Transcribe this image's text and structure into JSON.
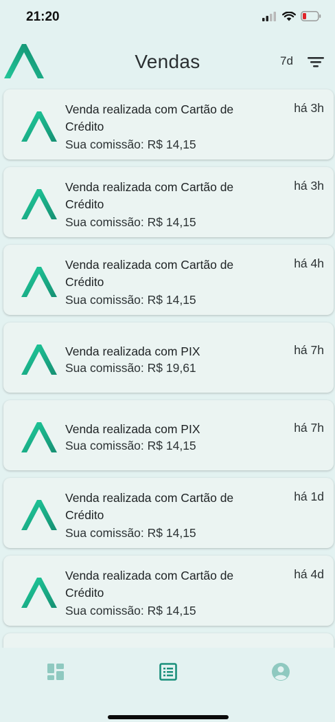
{
  "status_bar": {
    "time": "21:20"
  },
  "header": {
    "title": "Vendas",
    "period": "7d"
  },
  "colors": {
    "accent": "#1fa989",
    "background": "#e3f2f1",
    "card": "#ebf4f2"
  },
  "sales": [
    {
      "title": "Venda realizada com Cartão de Crédito",
      "commission": "Sua comissão: R$ 14,15",
      "time": "há 3h"
    },
    {
      "title": "Venda realizada com Cartão de Crédito",
      "commission": "Sua comissão: R$ 14,15",
      "time": "há 3h"
    },
    {
      "title": "Venda realizada com Cartão de Crédito",
      "commission": "Sua comissão: R$ 14,15",
      "time": "há 4h"
    },
    {
      "title": "Venda realizada com PIX",
      "commission": "Sua comissão: R$ 19,61",
      "time": "há 7h"
    },
    {
      "title": "Venda realizada com PIX",
      "commission": "Sua comissão: R$ 14,15",
      "time": "há 7h"
    },
    {
      "title": "Venda realizada com Cartão de Crédito",
      "commission": "Sua comissão: R$ 14,15",
      "time": "há 1d"
    },
    {
      "title": "Venda realizada com Cartão de Crédito",
      "commission": "Sua comissão: R$ 14,15",
      "time": "há 4d"
    }
  ],
  "nav": {
    "items": [
      "dashboard-icon",
      "list-icon",
      "profile-icon"
    ],
    "active": "list-icon"
  }
}
